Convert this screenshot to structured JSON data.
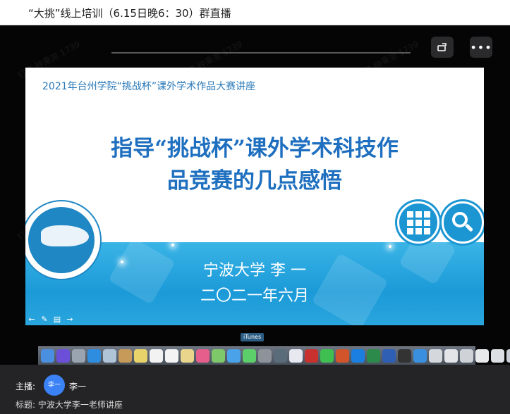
{
  "window": {
    "title": "“大挑”线上培训（6.15日晚6：30）群直播"
  },
  "controls": {
    "rotate_icon": "rotate-screen-icon",
    "more_label": "•••"
  },
  "watermark": {
    "text": "钉钉  钟秉渝 1739"
  },
  "slide": {
    "subheading": "2021年台州学院“挑战杯”课外学术作品大赛讲座",
    "title_line1": "指导“挑战杯”课外学术科技作",
    "title_line2": "品竞赛的几点感悟",
    "presenter": "宁波大学  李 一",
    "date": "二〇二一年六月",
    "accent_color": "#1e6fbf",
    "band_color": "#1b9ad8"
  },
  "slide_tools": [
    "←",
    "✎",
    "▤",
    "→"
  ],
  "dock": {
    "tooltip": "iTunes",
    "apps": [
      {
        "name": "finder-icon",
        "color": "#4a8fe0"
      },
      {
        "name": "siri-icon",
        "color": "#6b4fd8"
      },
      {
        "name": "launchpad-icon",
        "color": "#9aa4b0"
      },
      {
        "name": "safari-icon",
        "color": "#2f8de0"
      },
      {
        "name": "photo-icon",
        "color": "#b0c4d8"
      },
      {
        "name": "contacts-icon",
        "color": "#c79a5a"
      },
      {
        "name": "notes-icon",
        "color": "#e8d36a"
      },
      {
        "name": "calendar-icon",
        "color": "#f2f2f2"
      },
      {
        "name": "reminders-icon",
        "color": "#f4f4f4"
      },
      {
        "name": "stickies-icon",
        "color": "#e9d58c"
      },
      {
        "name": "photos-icon",
        "color": "#e65f8c"
      },
      {
        "name": "map-icon",
        "color": "#7fc86a"
      },
      {
        "name": "app-store-icon",
        "color": "#4aa3e8"
      },
      {
        "name": "messages-icon",
        "color": "#5ccf6a"
      },
      {
        "name": "settings-icon",
        "color": "#8e9399"
      },
      {
        "name": "time-machine-icon",
        "color": "#5a6b7a"
      },
      {
        "name": "itunes-icon",
        "color": "#e8e8f0"
      },
      {
        "name": "acrobat-icon",
        "color": "#c8312d"
      },
      {
        "name": "wechat-icon",
        "color": "#3fbf4f"
      },
      {
        "name": "powerpoint-icon",
        "color": "#d2542a"
      },
      {
        "name": "zhihu-icon",
        "color": "#1a7fe0"
      },
      {
        "name": "excel-icon",
        "color": "#2c8a4a"
      },
      {
        "name": "word-icon",
        "color": "#2f5fb4"
      },
      {
        "name": "qq-icon",
        "color": "#333333"
      },
      {
        "name": "testflight-icon",
        "color": "#3a8fdf"
      },
      {
        "name": "document-icon",
        "color": "#d4d8dc"
      },
      {
        "name": "document-icon",
        "color": "#e2e4e7"
      },
      {
        "name": "document-icon",
        "color": "#cfd3d8"
      },
      {
        "name": "document-icon",
        "color": "#e8eaec"
      },
      {
        "name": "document-icon",
        "color": "#dcdfe3"
      },
      {
        "name": "trash-icon",
        "color": "#c9ced4"
      }
    ]
  },
  "footer": {
    "host_label": "主播:",
    "avatar_text": "李一",
    "host_name": "李一",
    "topic": "标题:  宁波大学李一老师讲座"
  }
}
